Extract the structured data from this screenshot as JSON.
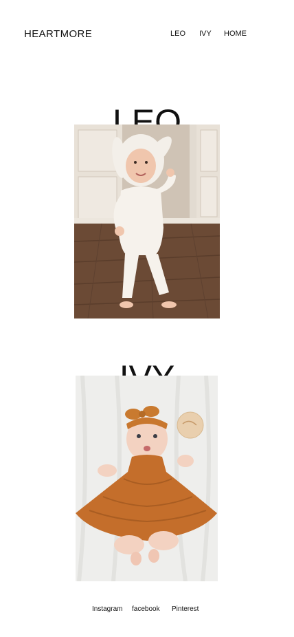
{
  "header": {
    "brand": "HEARTMORE",
    "nav": [
      {
        "label": "LEO"
      },
      {
        "label": "IVY"
      },
      {
        "label": "HOME"
      }
    ]
  },
  "sections": [
    {
      "title": "LEO",
      "photo_alt": "LEO"
    },
    {
      "title": "IVY",
      "photo_alt": "IVY"
    }
  ],
  "footer": {
    "links": [
      {
        "label": "Instagram"
      },
      {
        "label": "facebook"
      },
      {
        "label": "Pinterest"
      }
    ]
  },
  "colors": {
    "text": "#111111",
    "background": "#ffffff"
  }
}
